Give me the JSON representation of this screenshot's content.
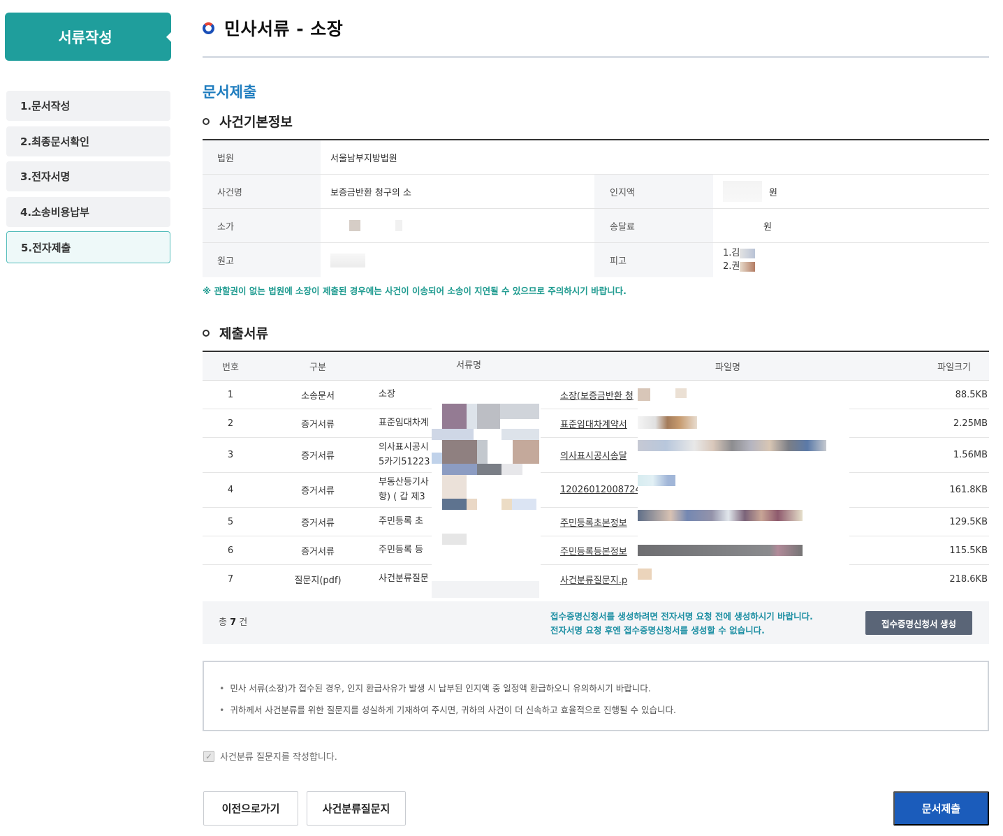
{
  "sidebar": {
    "title": "서류작성",
    "items": [
      {
        "label": "1.문서작성"
      },
      {
        "label": "2.최종문서확인"
      },
      {
        "label": "3.전자서명"
      },
      {
        "label": "4.소송비용납부"
      },
      {
        "label": "5.전자제출"
      }
    ],
    "active_index": 4
  },
  "header": {
    "title": "민사서류 - 소장"
  },
  "section": {
    "title": "문서제출"
  },
  "case_info": {
    "heading": "사건기본정보",
    "court_label": "법원",
    "court_value": "서울남부지방법원",
    "case_name_label": "사건명",
    "case_name_value": "보증금반환 청구의 소",
    "stamp_fee_label": "인지액",
    "stamp_fee_unit": "원",
    "claim_value_label": "소가",
    "service_fee_label": "송달료",
    "service_fee_unit": "원",
    "plaintiff_label": "원고",
    "defendant_label": "피고",
    "defendant_1": "1.김",
    "defendant_2": "2.권"
  },
  "notice": "※ 관할권이 없는 법원에 소장이 제출된 경우에는 사건이 이송되어 소송이 지연될 수 있으므로 주의하시기 바랍니다.",
  "documents": {
    "heading": "제출서류",
    "columns": {
      "no": "번호",
      "category": "구분",
      "doc_name": "서류명",
      "file_name": "파일명",
      "file_size": "파일크기"
    },
    "rows": [
      {
        "no": "1",
        "category": "소송문서",
        "doc_name": "소장",
        "doc_name_2": "",
        "file_name": "소장(보증금반환 청",
        "size": "88.5KB"
      },
      {
        "no": "2",
        "category": "증거서류",
        "doc_name": "표준임대차계",
        "doc_name_2": "",
        "file_name": "표준임대차계약서",
        "size": "2.25MB"
      },
      {
        "no": "3",
        "category": "증거서류",
        "doc_name": "의사표시공시",
        "doc_name_2": "5카기51223",
        "file_name": "의사표시공시송달",
        "size": "1.56MB"
      },
      {
        "no": "4",
        "category": "증거서류",
        "doc_name": "부동산등기사",
        "doc_name_2": "항) ( 갑 제3",
        "file_name": "12026012008724",
        "size": "161.8KB"
      },
      {
        "no": "5",
        "category": "증거서류",
        "doc_name": "주민등록 초",
        "doc_name_2": "",
        "file_name": "주민등록초본정보",
        "size": "129.5KB"
      },
      {
        "no": "6",
        "category": "증거서류",
        "doc_name": "주민등록 등",
        "doc_name_2": "",
        "file_name": "주민등록등본정보",
        "size": "115.5KB"
      },
      {
        "no": "7",
        "category": "질문지(pdf)",
        "doc_name": "사건분류질문",
        "doc_name_2": "",
        "file_name": "사건분류질문지.p",
        "size": "218.6KB"
      }
    ],
    "total_prefix": "총",
    "total_count": "7",
    "total_suffix": "건",
    "cert_message_1": "접수증명신청서를 생성하려면 전자서명 요청 전에 생성하시기 바랍니다.",
    "cert_message_2": "전자서명 요청 후엔 접수증명신청서를 생성할 수 없습니다.",
    "cert_button": "접수증명신청서 생성"
  },
  "guide": {
    "line1": "민사 서류(소장)가 접수된 경우, 인지 환급사유가 발생 시 납부된 인지액 중 일정액 환급하오니 유의하시기 바랍니다.",
    "line2": "귀하께서 사건분류를 위한 질문지를 성실하게 기재하여 주시면, 귀하의 사건이 더 신속하고 효율적으로 진행될 수 있습니다."
  },
  "checkbox": {
    "label": "사건분류 질문지를 작성합니다.",
    "checked": true
  },
  "buttons": {
    "back": "이전으로가기",
    "questionnaire": "사건분류질문지",
    "submit": "문서제출"
  },
  "colors": {
    "teal": "#1f9e9c",
    "blue": "#1b5cbb",
    "notice": "#1d9a8f"
  }
}
